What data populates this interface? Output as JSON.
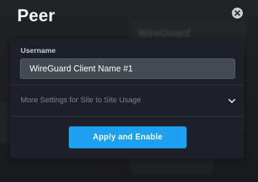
{
  "dialog": {
    "title": "Peer",
    "close_icon": "close-circle-icon"
  },
  "form": {
    "username_label": "Username",
    "username_value": "WireGuard Client Name #1",
    "more_settings_label": "More Settings for Site to Site Usage",
    "more_settings_icon": "chevron-down-icon",
    "more_settings_expanded": false,
    "apply_label": "Apply and Enable"
  },
  "background": {
    "blurred_heading": "WireGuard"
  },
  "colors": {
    "accent": "#1ea1f1",
    "panel": "#1b2126",
    "input": "#444a51"
  }
}
